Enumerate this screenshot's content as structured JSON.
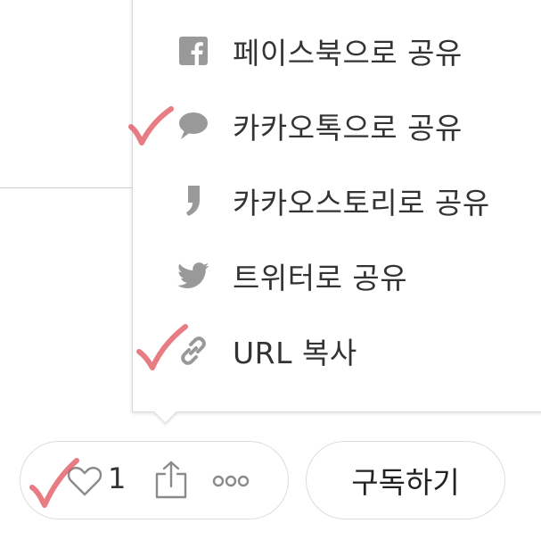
{
  "share_menu": {
    "items": [
      {
        "label": "페이스북으로 공유",
        "icon": "facebook-icon"
      },
      {
        "label": "카카오톡으로 공유",
        "icon": "kakaotalk-icon"
      },
      {
        "label": "카카오스토리로 공유",
        "icon": "kakaostory-icon"
      },
      {
        "label": "트위터로 공유",
        "icon": "twitter-icon"
      },
      {
        "label": "URL 복사",
        "icon": "link-icon"
      }
    ]
  },
  "action_bar": {
    "like_icon": "heart-icon",
    "like_count": "1",
    "share_icon": "share-icon",
    "more_icon": "more-icon"
  },
  "subscribe_label": "구독하기",
  "colors": {
    "icon_gray": "#999999",
    "text": "#333333",
    "border": "#dcdcdc",
    "checkmark": "#e0505a"
  }
}
